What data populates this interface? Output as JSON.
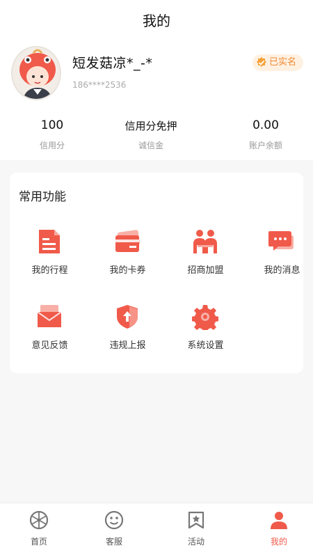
{
  "header": {
    "title": "我的"
  },
  "profile": {
    "username": "短发菇凉*_-*",
    "phone": "186****2536",
    "verified_label": "已实名",
    "avatar_icon": "cartoon-avatar-icon"
  },
  "stats": [
    {
      "value": "100",
      "label": "信用分"
    },
    {
      "value": "信用分免押",
      "label": "诚信金"
    },
    {
      "value": "0.00",
      "label": "账户余额"
    }
  ],
  "functions": {
    "title": "常用功能",
    "items": [
      {
        "label": "我的行程",
        "icon": "document-icon"
      },
      {
        "label": "我的卡券",
        "icon": "card-icon"
      },
      {
        "label": "招商加盟",
        "icon": "people-icon"
      },
      {
        "label": "我的消息",
        "icon": "message-icon"
      },
      {
        "label": "意见反馈",
        "icon": "feedback-mail-icon"
      },
      {
        "label": "违规上报",
        "icon": "shield-upload-icon"
      },
      {
        "label": "系统设置",
        "icon": "gear-icon"
      }
    ]
  },
  "tabbar": [
    {
      "label": "首页",
      "icon": "wheel-icon"
    },
    {
      "label": "客服",
      "icon": "smile-icon"
    },
    {
      "label": "活动",
      "icon": "bookmark-star-icon"
    },
    {
      "label": "我的",
      "icon": "person-icon",
      "active": true
    }
  ],
  "colors": {
    "accent": "#f05a4a",
    "verified_bg": "#fff1e2",
    "verified_text": "#f08a33"
  }
}
